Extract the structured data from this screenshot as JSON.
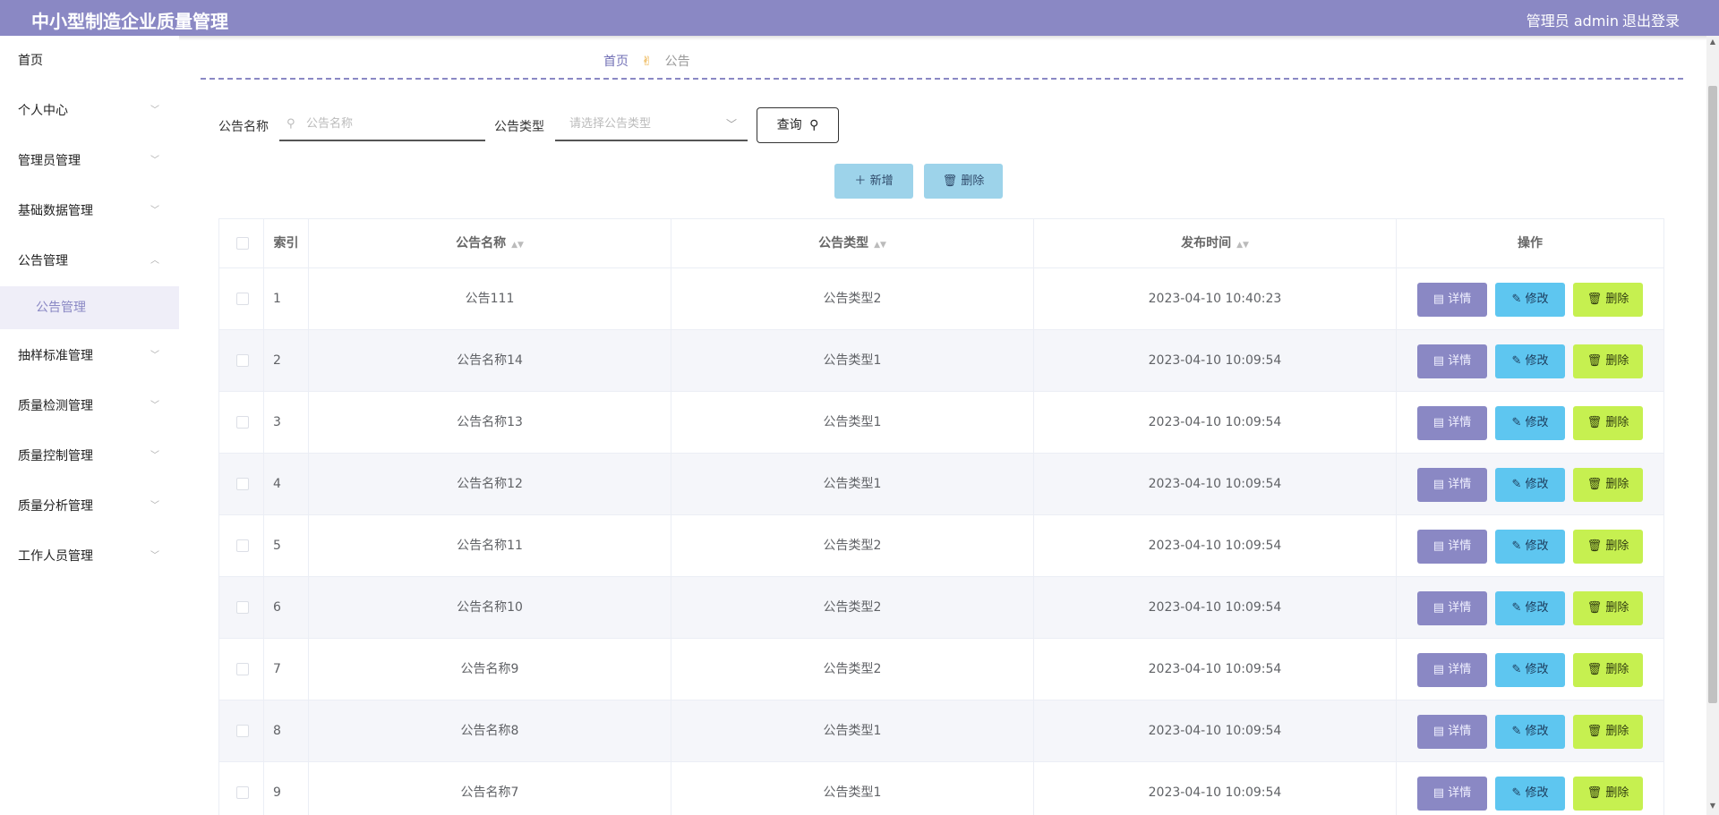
{
  "header": {
    "title": "中小型制造企业质量管理",
    "user": "管理员 admin",
    "logout": "退出登录"
  },
  "sidebar": {
    "items": [
      {
        "label": "首页",
        "has_chevron": false
      },
      {
        "label": "个人中心",
        "has_chevron": true
      },
      {
        "label": "管理员管理",
        "has_chevron": true
      },
      {
        "label": "基础数据管理",
        "has_chevron": true
      },
      {
        "label": "公告管理",
        "has_chevron": true,
        "expanded": true
      },
      {
        "label": "抽样标准管理",
        "has_chevron": true
      },
      {
        "label": "质量检测管理",
        "has_chevron": true
      },
      {
        "label": "质量控制管理",
        "has_chevron": true
      },
      {
        "label": "质量分析管理",
        "has_chevron": true
      },
      {
        "label": "工作人员管理",
        "has_chevron": true
      }
    ],
    "active_sub": "公告管理"
  },
  "breadcrumb": {
    "home": "首页",
    "separator": "✌",
    "current": "公告"
  },
  "search": {
    "name_label": "公告名称",
    "name_placeholder": "公告名称",
    "type_label": "公告类型",
    "type_placeholder": "请选择公告类型",
    "query_label": "查询"
  },
  "actions": {
    "add_label": "新增",
    "delete_label": "删除"
  },
  "table": {
    "columns": {
      "index": "索引",
      "name": "公告名称",
      "type": "公告类型",
      "time": "发布时间",
      "ops": "操作"
    },
    "op_labels": {
      "detail": "详情",
      "edit": "修改",
      "delete": "删除"
    },
    "rows": [
      {
        "index": "1",
        "name": "公告111",
        "type": "公告类型2",
        "time": "2023-04-10 10:40:23"
      },
      {
        "index": "2",
        "name": "公告名称14",
        "type": "公告类型1",
        "time": "2023-04-10 10:09:54"
      },
      {
        "index": "3",
        "name": "公告名称13",
        "type": "公告类型1",
        "time": "2023-04-10 10:09:54"
      },
      {
        "index": "4",
        "name": "公告名称12",
        "type": "公告类型1",
        "time": "2023-04-10 10:09:54"
      },
      {
        "index": "5",
        "name": "公告名称11",
        "type": "公告类型2",
        "time": "2023-04-10 10:09:54"
      },
      {
        "index": "6",
        "name": "公告名称10",
        "type": "公告类型2",
        "time": "2023-04-10 10:09:54"
      },
      {
        "index": "7",
        "name": "公告名称9",
        "type": "公告类型2",
        "time": "2023-04-10 10:09:54"
      },
      {
        "index": "8",
        "name": "公告名称8",
        "type": "公告类型1",
        "time": "2023-04-10 10:09:54"
      },
      {
        "index": "9",
        "name": "公告名称7",
        "type": "公告类型1",
        "time": "2023-04-10 10:09:54"
      }
    ]
  },
  "colors": {
    "header_bg": "#8a88c4",
    "detail_btn": "#8a88c4",
    "edit_btn": "#5ec6f0",
    "delete_btn": "#c6f050",
    "action_btn": "#9dd3ea"
  }
}
